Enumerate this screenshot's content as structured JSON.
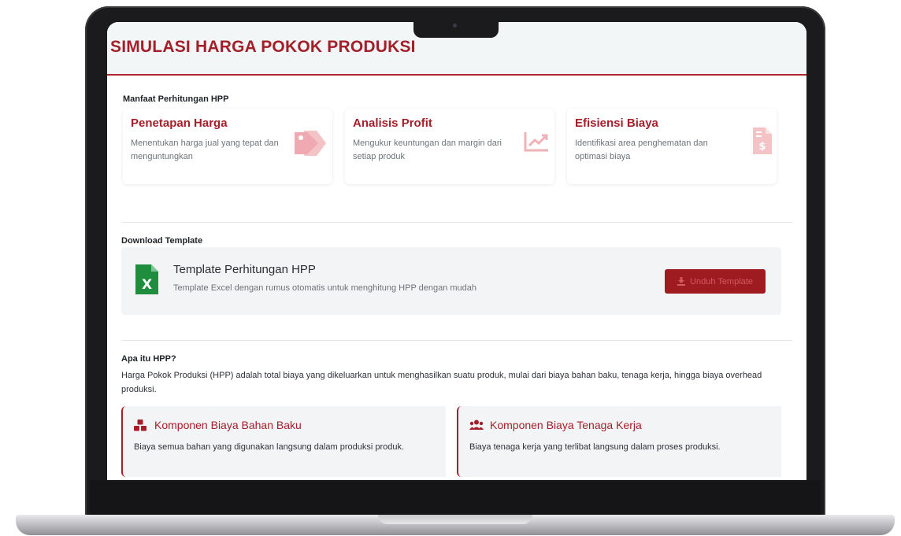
{
  "page": {
    "title": "SIMULASI HARGA POKOK PRODUKSI"
  },
  "benefits": {
    "label": "Manfaat Perhitungan HPP",
    "items": [
      {
        "title": "Penetapan Harga",
        "desc": "Menentukan harga jual yang tepat dan menguntungkan",
        "icon": "tags-icon"
      },
      {
        "title": "Analisis Profit",
        "desc": "Mengukur keuntungan dan margin dari setiap produk",
        "icon": "chart-line-icon"
      },
      {
        "title": "Efisiensi Biaya",
        "desc": "Identifikasi area penghematan dan optimasi biaya",
        "icon": "invoice-dollar-icon"
      }
    ]
  },
  "download": {
    "label": "Download Template",
    "template_title": "Template Perhitungan HPP",
    "template_desc": "Template Excel dengan rumus otomatis untuk menghitung HPP dengan mudah",
    "button_label": "Unduh Template",
    "file_icon": "excel-file-icon",
    "button_icon": "download-icon"
  },
  "about": {
    "label": "Apa itu HPP?",
    "desc": "Harga Pokok Produksi (HPP) adalah total biaya yang dikeluarkan untuk menghasilkan suatu produk, mulai dari biaya bahan baku, tenaga kerja, hingga biaya overhead produksi."
  },
  "components": [
    {
      "title": "Komponen Biaya Bahan Baku",
      "desc": "Biaya semua bahan yang digunakan langsung dalam produksi produk.",
      "icon": "cubes-icon"
    },
    {
      "title": "Komponen Biaya Tenaga Kerja",
      "desc": "Biaya tenaga kerja yang terlibat langsung dalam proses produksi.",
      "icon": "users-icon"
    }
  ],
  "colors": {
    "brand": "#a31f2a",
    "button": "#9e1b1f",
    "excel_green": "#1e8e3e",
    "faded_icon": "#f3c3c6"
  }
}
